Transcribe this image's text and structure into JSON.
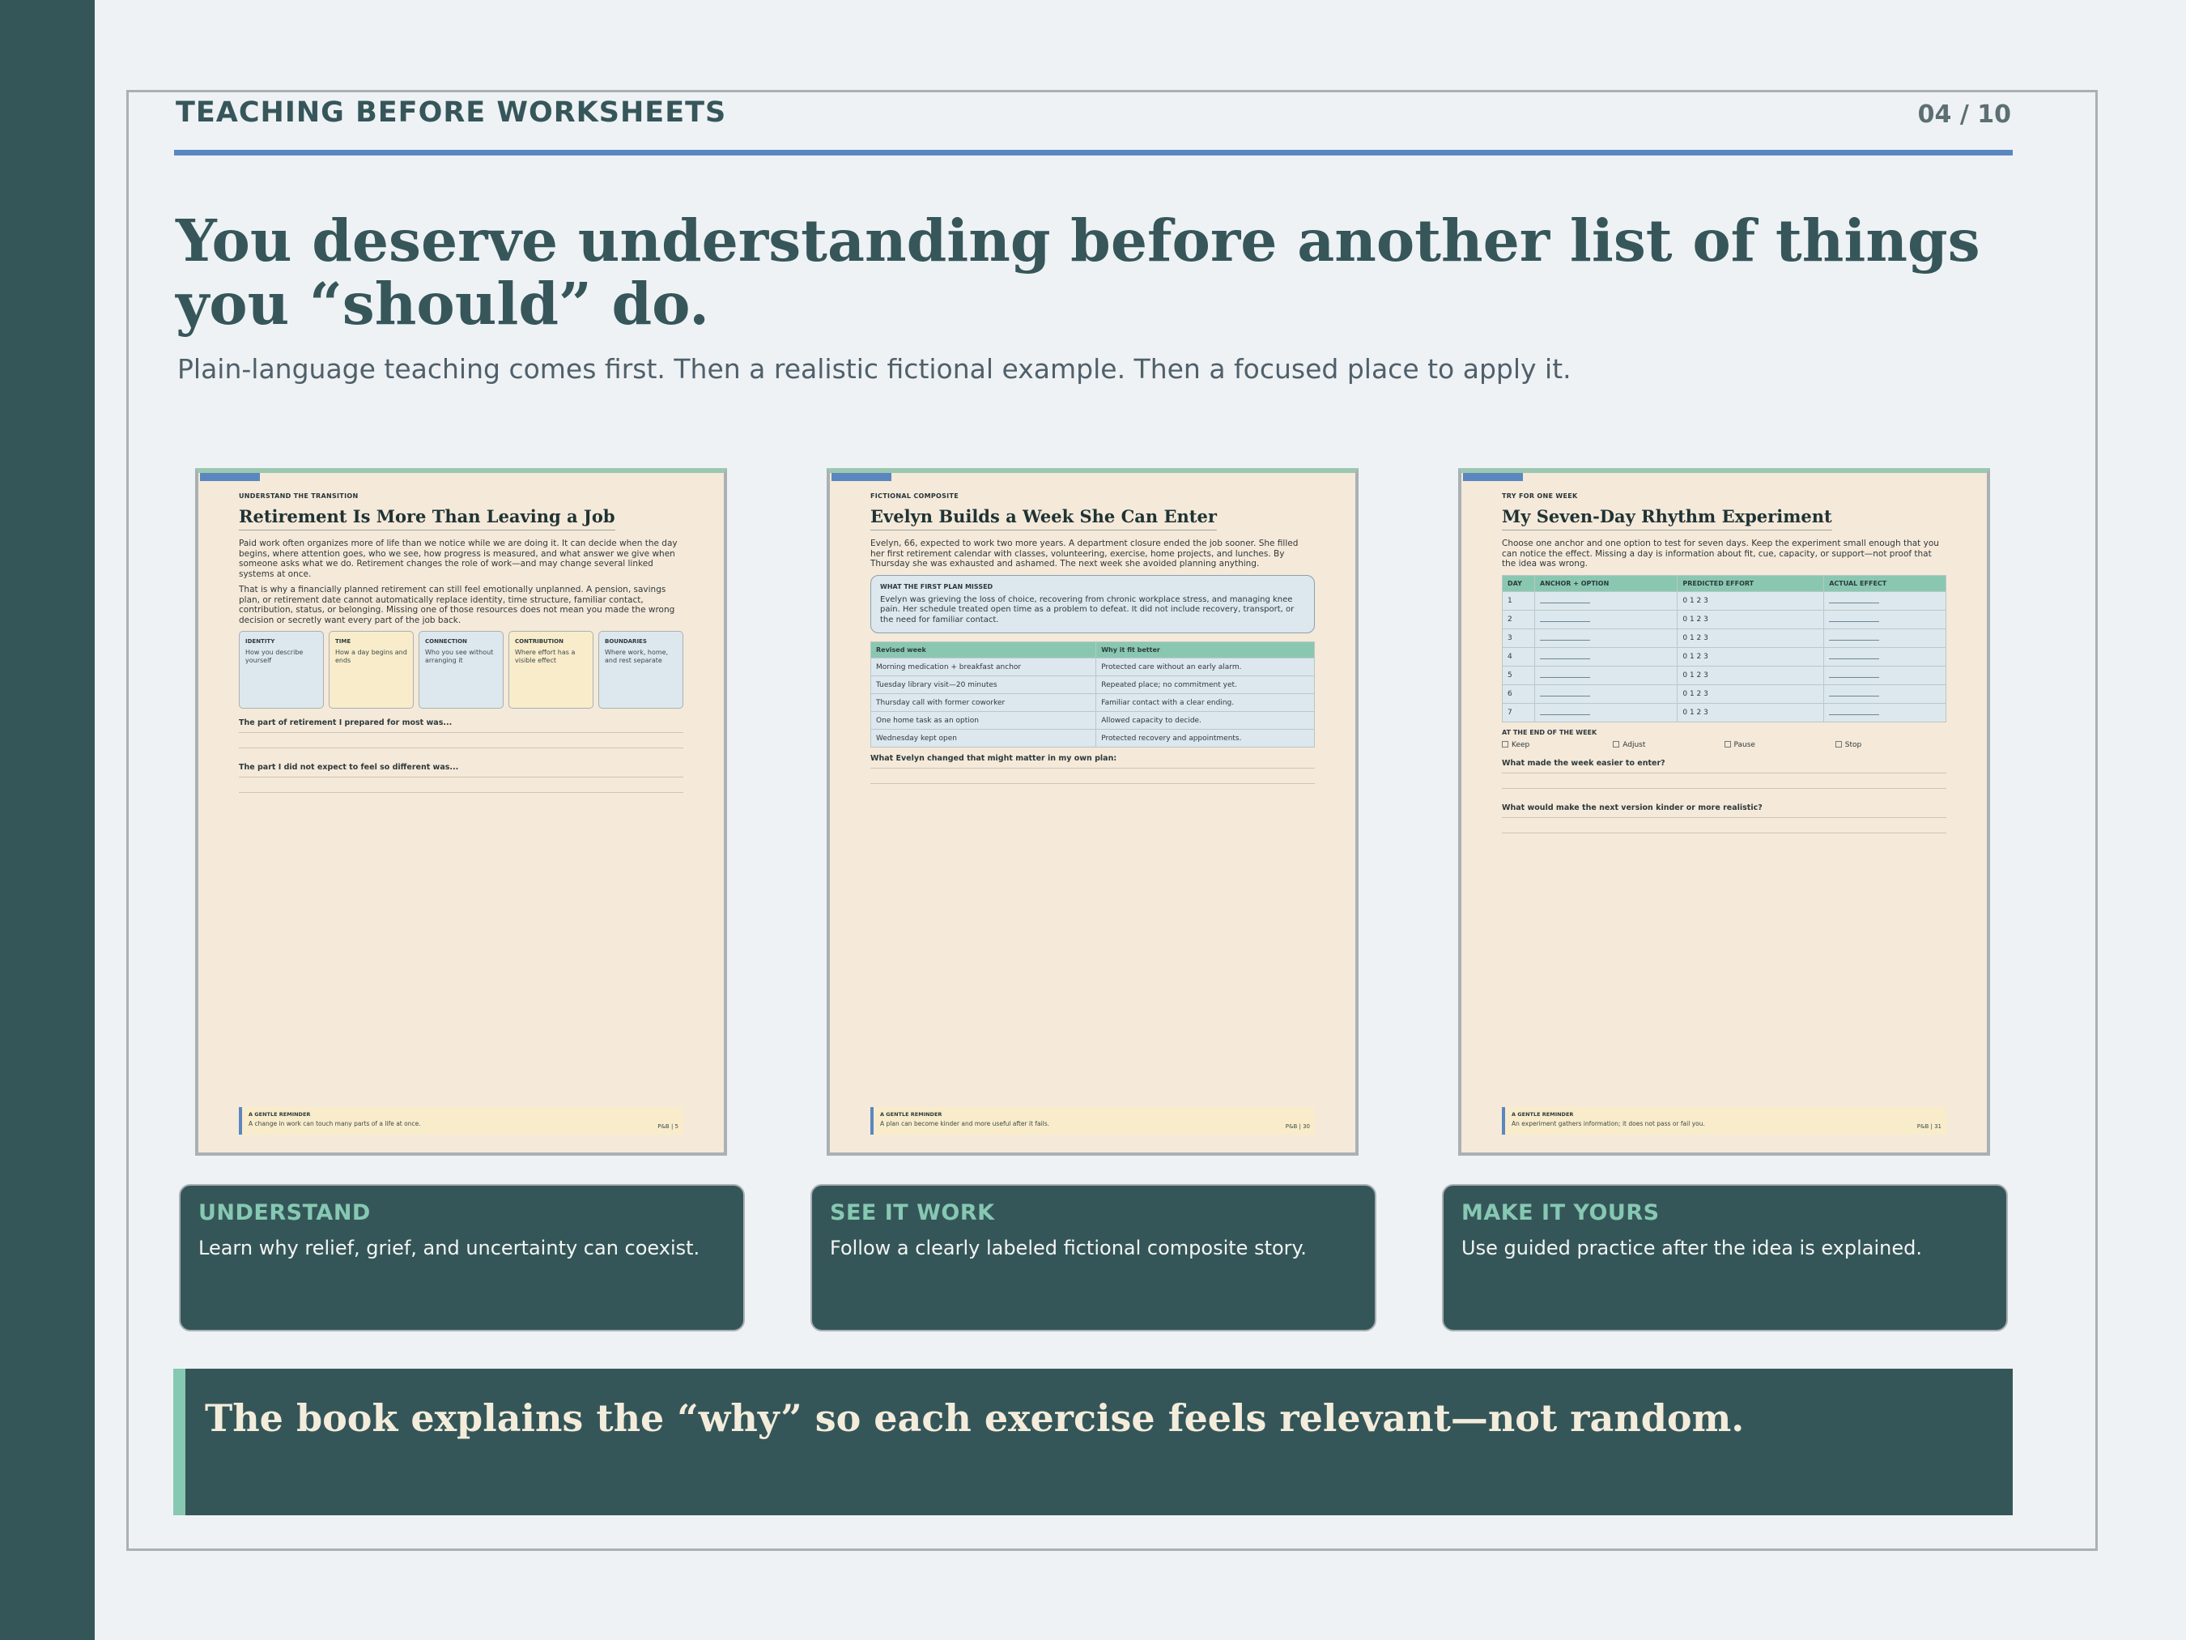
{
  "header": {
    "kicker": "TEACHING BEFORE WORKSHEETS",
    "page_number": "04 / 10",
    "headline": "You deserve understanding before another list of things you “should” do.",
    "subline": "Plain-language teaching comes first. Then a realistic fictional example. Then a focused place to apply it."
  },
  "worksheets": [
    {
      "kicker": "UNDERSTAND THE TRANSITION",
      "title": "Retirement Is More Than Leaving a Job",
      "paragraphs": [
        "Paid work often organizes more of life than we notice while we are doing it. It can decide when the day begins, where attention goes, who we see, how progress is measured, and what answer we give when someone asks what we do. Retirement changes the role of work—and may change several linked systems at once.",
        "That is why a financially planned retirement can still feel emotionally unplanned. A pension, savings plan, or retirement date cannot automatically replace identity, time structure, familiar contact, contribution, status, or belonging. Missing one of those resources does not mean you made the wrong decision or secretly want every part of the job back."
      ],
      "cards": [
        {
          "title": "IDENTITY",
          "desc": "How you describe yourself"
        },
        {
          "title": "TIME",
          "desc": "How a day begins and ends"
        },
        {
          "title": "CONNECTION",
          "desc": "Who you see without arranging it"
        },
        {
          "title": "CONTRIBUTION",
          "desc": "Where effort has a visible effect"
        },
        {
          "title": "BOUNDARIES",
          "desc": "Where work, home, and rest separate"
        }
      ],
      "prompts": [
        "The part of retirement I prepared for most was...",
        "The part I did not expect to feel so different was..."
      ],
      "reminder": {
        "title": "A GENTLE REMINDER",
        "text": "A change in work can touch many parts of a life at once.",
        "page": "P&B  |  5"
      }
    },
    {
      "kicker": "FICTIONAL COMPOSITE",
      "title": "Evelyn Builds a Week She Can Enter",
      "paragraph": "Evelyn, 66, expected to work two more years. A department closure ended the job sooner. She filled her first retirement calendar with classes, volunteering, exercise, home projects, and lunches. By Thursday she was exhausted and ashamed. The next week she avoided planning anything.",
      "callout": {
        "title": "WHAT THE FIRST PLAN MISSED",
        "text": "Evelyn was grieving the loss of choice, recovering from chronic workplace stress, and managing knee pain. Her schedule treated open time as a problem to defeat. It did not include recovery, transport, or the need for familiar contact."
      },
      "table": {
        "headers": [
          "Revised week",
          "Why it fit better"
        ],
        "rows": [
          [
            "Morning medication + breakfast anchor",
            "Protected care without an early alarm."
          ],
          [
            "Tuesday library visit—20 minutes",
            "Repeated place; no commitment yet."
          ],
          [
            "Thursday call with former coworker",
            "Familiar contact with a clear ending."
          ],
          [
            "One home task as an option",
            "Allowed capacity to decide."
          ],
          [
            "Wednesday kept open",
            "Protected recovery and appointments."
          ]
        ]
      },
      "prompt": "What Evelyn changed that might matter in my own plan:",
      "reminder": {
        "title": "A GENTLE REMINDER",
        "text": "A plan can become kinder and more useful after it fails.",
        "page": "P&B  |  30"
      }
    },
    {
      "kicker": "TRY FOR ONE WEEK",
      "title": "My Seven-Day Rhythm Experiment",
      "paragraph": "Choose one anchor and one option to test for seven days. Keep the experiment small enough that you can notice the effect. Missing a day is information about fit, cue, capacity, or support—not proof that the idea was wrong.",
      "table": {
        "headers": [
          "DAY",
          "ANCHOR + OPTION",
          "PREDICTED EFFORT",
          "ACTUAL EFFECT"
        ],
        "days": [
          "1",
          "2",
          "3",
          "4",
          "5",
          "6",
          "7"
        ],
        "effort_scale": "0 1 2 3"
      },
      "end_of_week": {
        "title": "AT THE END OF THE WEEK",
        "options": [
          "Keep",
          "Adjust",
          "Pause",
          "Stop"
        ]
      },
      "prompts": [
        "What made the week easier to enter?",
        "What would make the next version kinder or more realistic?"
      ],
      "reminder": {
        "title": "A GENTLE REMINDER",
        "text": "An experiment gathers information; it does not pass or fail you.",
        "page": "P&B  |  31"
      }
    }
  ],
  "captions": [
    {
      "title": "UNDERSTAND",
      "text": "Learn why relief, grief, and uncertainty can coexist."
    },
    {
      "title": "SEE IT WORK",
      "text": "Follow a clearly labeled fictional composite story."
    },
    {
      "title": "MAKE IT YOURS",
      "text": "Use guided practice after the idea is explained."
    }
  ],
  "banner": "The book explains the “why” so each exercise feels relevant—not random."
}
